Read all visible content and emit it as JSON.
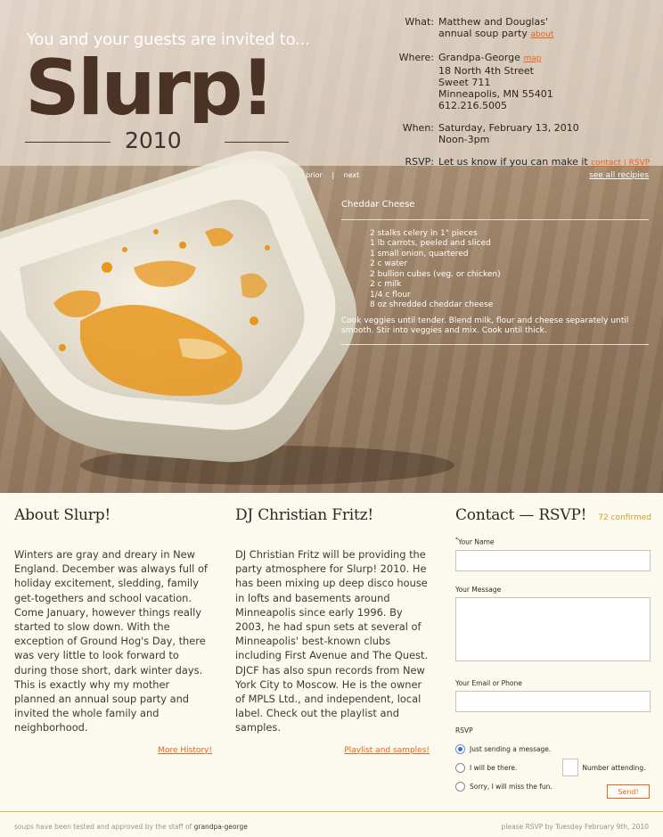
{
  "hero": {
    "invite_line": "You and your guests are invited to...",
    "logo_text": "Slurp!",
    "year": "2010"
  },
  "details": {
    "what_label": "What:",
    "what_line1": "Matthew and Douglas'",
    "what_line2": "annual soup party",
    "about_link": "about",
    "where_label": "Where:",
    "where_name": "Grandpa-George",
    "map_link": "map",
    "where_line2": "18 North 4th Street",
    "where_line3": "Sweet 711",
    "where_line4": "Minneapolis, MN 55401",
    "where_phone": "612.216.5005",
    "when_label": "When:",
    "when_date": "Saturday, February 13, 2010",
    "when_time": "Noon-3pm",
    "rsvp_label": "RSVP:",
    "rsvp_text": "Let us know if you can make it",
    "rsvp_link": "contact | RSVP"
  },
  "recipe": {
    "prior": "prior",
    "separator": "|",
    "next": "next",
    "see_all": "see all recipies",
    "title": "Cheddar Cheese",
    "ingredients": [
      "2 stalks celery in 1\" pieces",
      "1 lb carrots, peeled and sliced",
      "1 small onion, quartered",
      "2 c water",
      "2 bullion cubes (veg. or chicken)",
      "2 c milk",
      "1/4 c flour",
      "8 oz shredded cheddar cheese"
    ],
    "method": "Cook veggies until tender. Blend milk, flour and cheese separately until smooth. Stir into veggies and mix. Cook until thick."
  },
  "about": {
    "heading": "About Slurp!",
    "body": "Winters are gray and dreary in New England. December was always full of holiday excitement, sledding, family get-togethers and school vacation. Come January, however things really started to slow down. With the exception of Ground Hog's Day, there was very little to look forward to during those short, dark winter days. This is exactly why my mother planned an annual soup party and invited the whole family and neighborhood.",
    "more_link": "More History!"
  },
  "dj": {
    "heading": "DJ Christian Fritz!",
    "body": "DJ Christian Fritz will be providing the party atmosphere for Slurp! 2010. He has been mixing up deep disco house in lofts and basements around Minneapolis since early 1996. By 2003, he had spun sets at several of Minneapolis' best-known clubs including First Avenue and The Quest. DJCF has also spun records from New York City to Moscow. He is the owner of MPLS Ltd., and independent, local label. Check out the playlist and samples.",
    "more_link": "Playlist and samples!"
  },
  "contact": {
    "heading": "Contact — RSVP!",
    "confirmed": "72 confirmed",
    "name_required_mark": "*",
    "name_label": "Your Name",
    "message_label": "Your Message",
    "email_label": "Your Email or Phone",
    "rsvp_label": "RSVP",
    "option_message": "Just sending a message.",
    "option_there": "I will be there.",
    "number_label": "Number attending.",
    "option_miss": "Sorry, I will miss the fun.",
    "send_label": "Send!"
  },
  "footer": {
    "left_text": "soups have been tested and approved by the staff of",
    "left_brand": "grandpa-george",
    "right_text": "please RSVP by Tuesday February 9th, 2010"
  },
  "colors": {
    "accent": "#e8641c",
    "confirmed": "#d9a021",
    "logo": "#4a3224",
    "page_background": "#fcf9ef"
  }
}
